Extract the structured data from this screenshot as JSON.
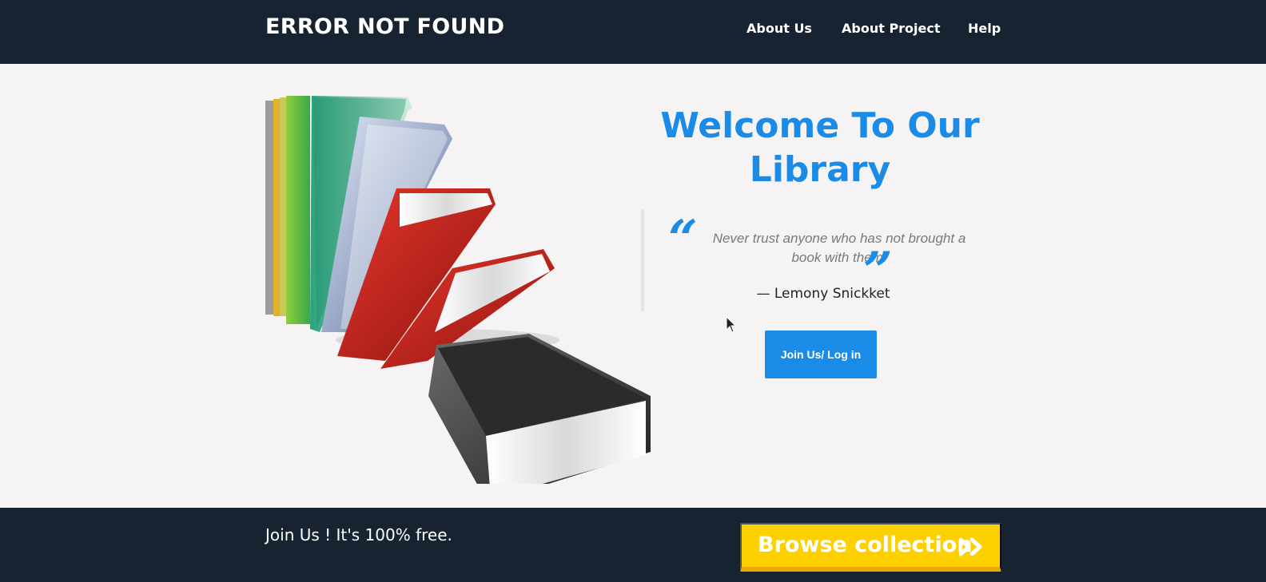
{
  "navbar": {
    "brand": "ERROR NOT FOUND",
    "links": [
      "About Us",
      "About Project",
      "Help"
    ]
  },
  "hero": {
    "title": "Welcome To Our Library",
    "quote": {
      "text": "Never trust anyone who has not brought a book with them.",
      "author": "— Lemony Snickket"
    },
    "join_button": "Join Us/ Log in",
    "image_icon": "books-illustration"
  },
  "footer": {
    "text": "Join Us ! It's 100% free.",
    "browse_button": "Browse collection",
    "browse_icon": "double-chevron-right-icon"
  },
  "colors": {
    "navbar_bg": "#172331",
    "accent_blue": "#1a8be6",
    "accent_yellow": "#fdd000",
    "page_bg": "#f5f3f4"
  }
}
